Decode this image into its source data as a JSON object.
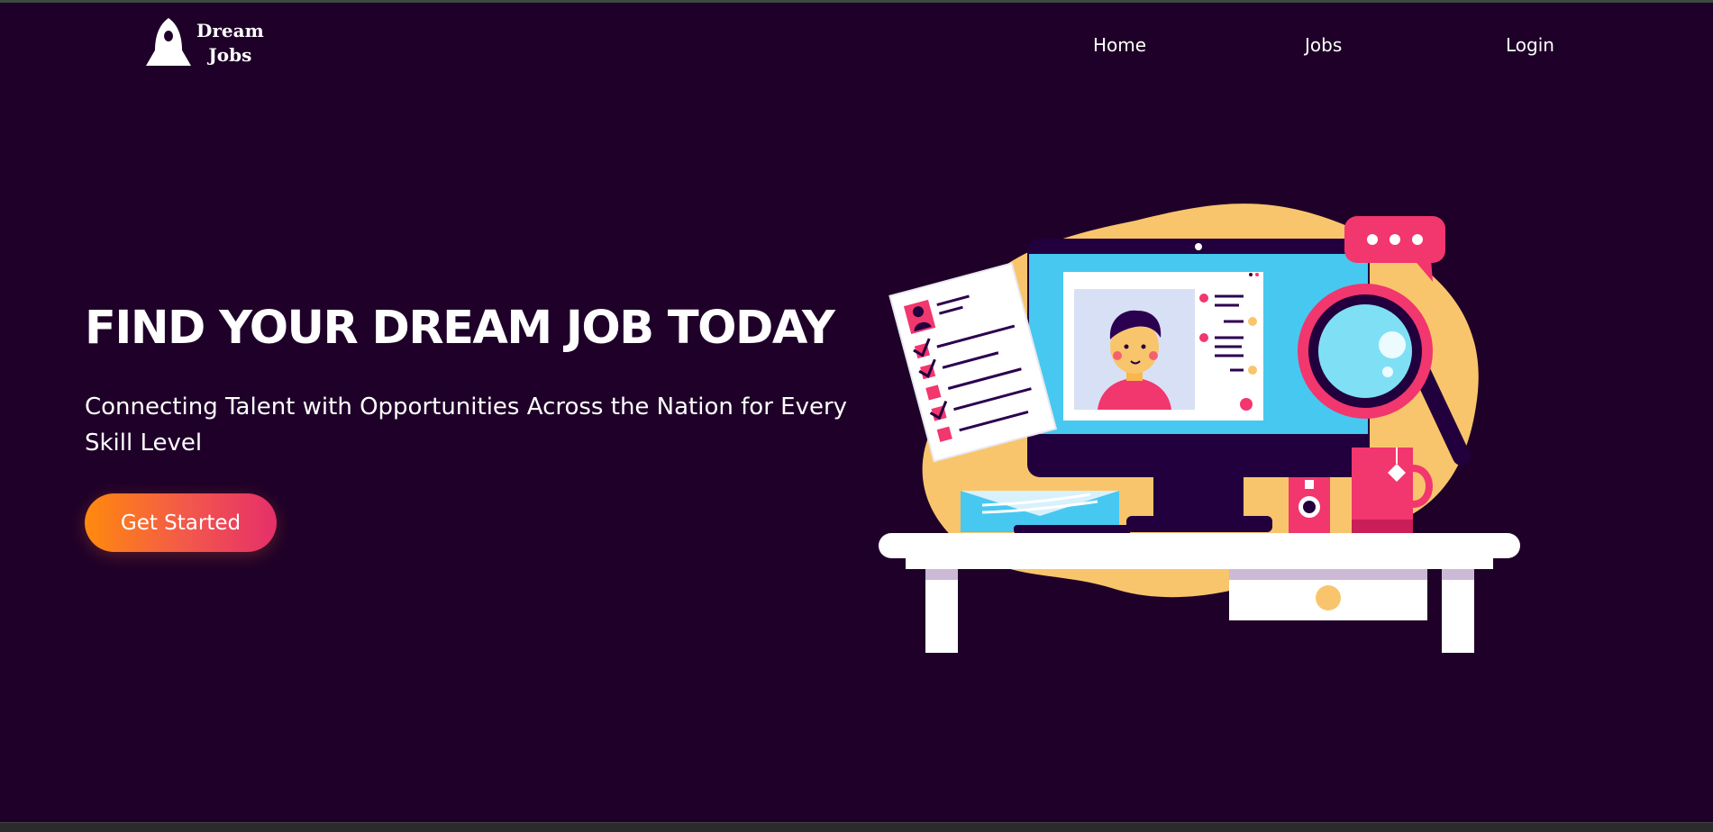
{
  "brand": {
    "line1": "Dream",
    "line2": "Jobs",
    "logo_icon": "rocket-icon"
  },
  "nav": {
    "home": "Home",
    "jobs": "Jobs",
    "login": "Login"
  },
  "hero": {
    "title": "FIND YOUR DREAM JOB TODAY",
    "subtitle": "Connecting Talent with Opportunities Across the Nation for Every Skill Level",
    "cta_label": "Get Started"
  },
  "colors": {
    "background": "#1f0029",
    "accent_orange": "#ff8a0d",
    "accent_pink": "#e52f6a",
    "illustration_yellow": "#f9c56c",
    "illustration_blue": "#47c8f0"
  }
}
